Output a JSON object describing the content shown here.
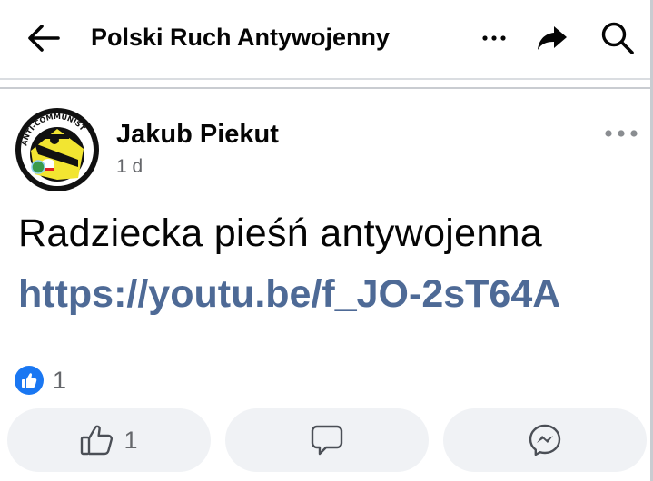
{
  "header": {
    "title": "Polski Ruch Antywojenny"
  },
  "post": {
    "author": "Jakub Piekut",
    "time": "1 d",
    "avatar_text": "ANTI-COMMUNIST",
    "text": "Radziecka pieśń antywojenna",
    "link": "https://youtu.be/f_JO-2sT64A"
  },
  "reactions": {
    "count": "1"
  },
  "actions": {
    "like_count": "1"
  },
  "colors": {
    "link": "#4e6a96",
    "like_blue": "#1a77f2",
    "button_bg": "#f0f2f5",
    "secondary_text": "#65676b"
  },
  "icons": {
    "back": "arrow-left-icon",
    "more": "more-horizontal-icon",
    "share": "share-arrow-icon",
    "search": "search-icon",
    "post_menu": "more-horizontal-icon",
    "reaction": "thumbs-up-icon",
    "like": "thumbs-up-outline-icon",
    "comment": "comment-icon",
    "send": "messenger-icon"
  }
}
